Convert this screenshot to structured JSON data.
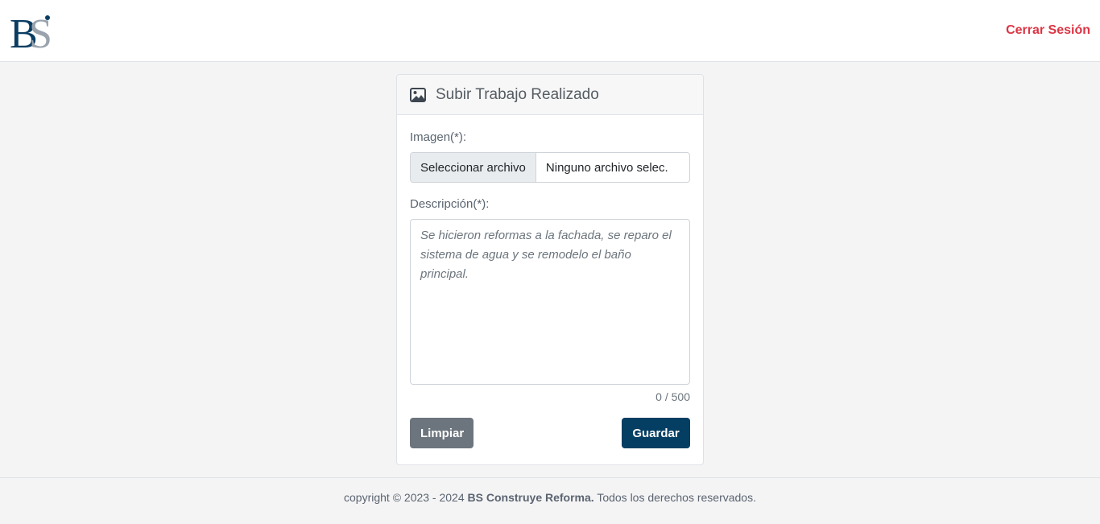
{
  "brand": {
    "logo_text": "BS",
    "logo_colors": [
      "#0a3d62",
      "#9aa3ad"
    ]
  },
  "navbar": {
    "logout_label": "Cerrar Sesión",
    "logout_color": "#dc3545"
  },
  "card": {
    "icon": "image-icon",
    "title": "Subir Trabajo Realizado",
    "image_label": "Imagen(*):",
    "file_button_label": "Seleccionar archivo",
    "file_status": "Ninguno archivo selec.",
    "description_label": "Descripción(*):",
    "description_placeholder": "Se hicieron reformas a la fachada, se reparo el sistema de agua y se remodelo el baño principal.",
    "description_value": "",
    "char_counter": "0 / 500",
    "clear_label": "Limpiar",
    "save_label": "Guardar"
  },
  "colors": {
    "primary": "#053e63",
    "secondary": "#6c757d",
    "danger": "#dc3545"
  },
  "footer": {
    "prefix": "copyright © 2023 - 2024 ",
    "company": "BS Construye Reforma.",
    "suffix": " Todos los derechos reservados."
  }
}
